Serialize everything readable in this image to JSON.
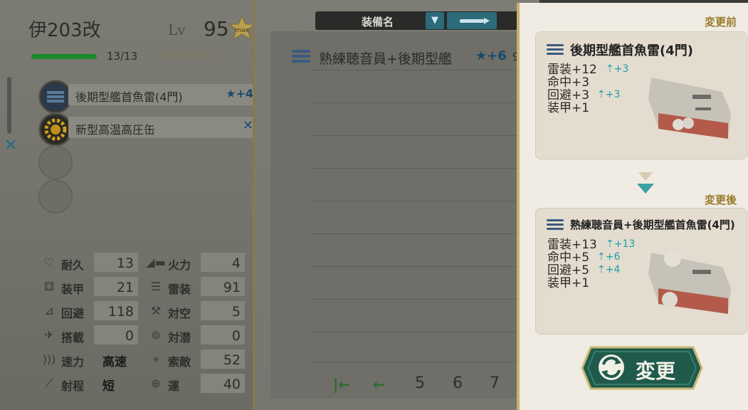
{
  "ship": {
    "name": "伊203改",
    "lv_label": "Lv",
    "level": "95",
    "hp": "13/13",
    "stars": "☆☆☆☆☆",
    "badge_text": "max"
  },
  "slots": [
    {
      "name": "後期型艦首魚雷(4門)",
      "improvement": "★+4"
    },
    {
      "name": "新型高温高圧缶",
      "improvement": ""
    },
    {
      "name": "",
      "improvement": ""
    },
    {
      "name": "",
      "improvement": ""
    }
  ],
  "stats": {
    "hp": {
      "label": "耐久",
      "value": "13"
    },
    "firepower": {
      "label": "火力",
      "value": "4"
    },
    "armor": {
      "label": "装甲",
      "value": "21"
    },
    "torpedo": {
      "label": "雷装",
      "value": "91"
    },
    "evasion": {
      "label": "回避",
      "value": "118"
    },
    "aa": {
      "label": "対空",
      "value": "5"
    },
    "aircraft": {
      "label": "搭載",
      "value": "0"
    },
    "asw": {
      "label": "対潜",
      "value": "0"
    },
    "speed": {
      "label": "速力",
      "value": "高速"
    },
    "los": {
      "label": "索敵",
      "value": "52"
    },
    "range": {
      "label": "射程",
      "value": "短"
    },
    "luck": {
      "label": "運",
      "value": "40"
    }
  },
  "list": {
    "header_label": "装備名",
    "sort_icon": "▼",
    "item": {
      "name": "熟練聴音員+後期型艦",
      "improvement": "★+6",
      "extra": "9"
    },
    "pages": [
      "5",
      "6",
      "7"
    ]
  },
  "compare": {
    "before_label": "変更前",
    "after_label": "変更後",
    "before": {
      "title": "後期型艦首魚雷(4門)",
      "stats": [
        {
          "text": "雷装+12",
          "delta": "+3"
        },
        {
          "text": "命中+3",
          "delta": ""
        },
        {
          "text": "回避+3",
          "delta": "+3"
        },
        {
          "text": "装甲+1",
          "delta": ""
        }
      ]
    },
    "after": {
      "title": "熟練聴音員+後期型艦首魚雷(4門)",
      "stats": [
        {
          "text": "雷装+13",
          "delta": "+13"
        },
        {
          "text": "命中+5",
          "delta": "+6"
        },
        {
          "text": "回避+5",
          "delta": "+4"
        },
        {
          "text": "装甲+1",
          "delta": ""
        }
      ]
    },
    "button_label": "変更"
  },
  "colors": {
    "accent_teal": "#2d6a7a",
    "hp_green": "#1a8a2a",
    "button_green": "#1f5a4c",
    "delta_cyan": "#1aa0a8"
  }
}
